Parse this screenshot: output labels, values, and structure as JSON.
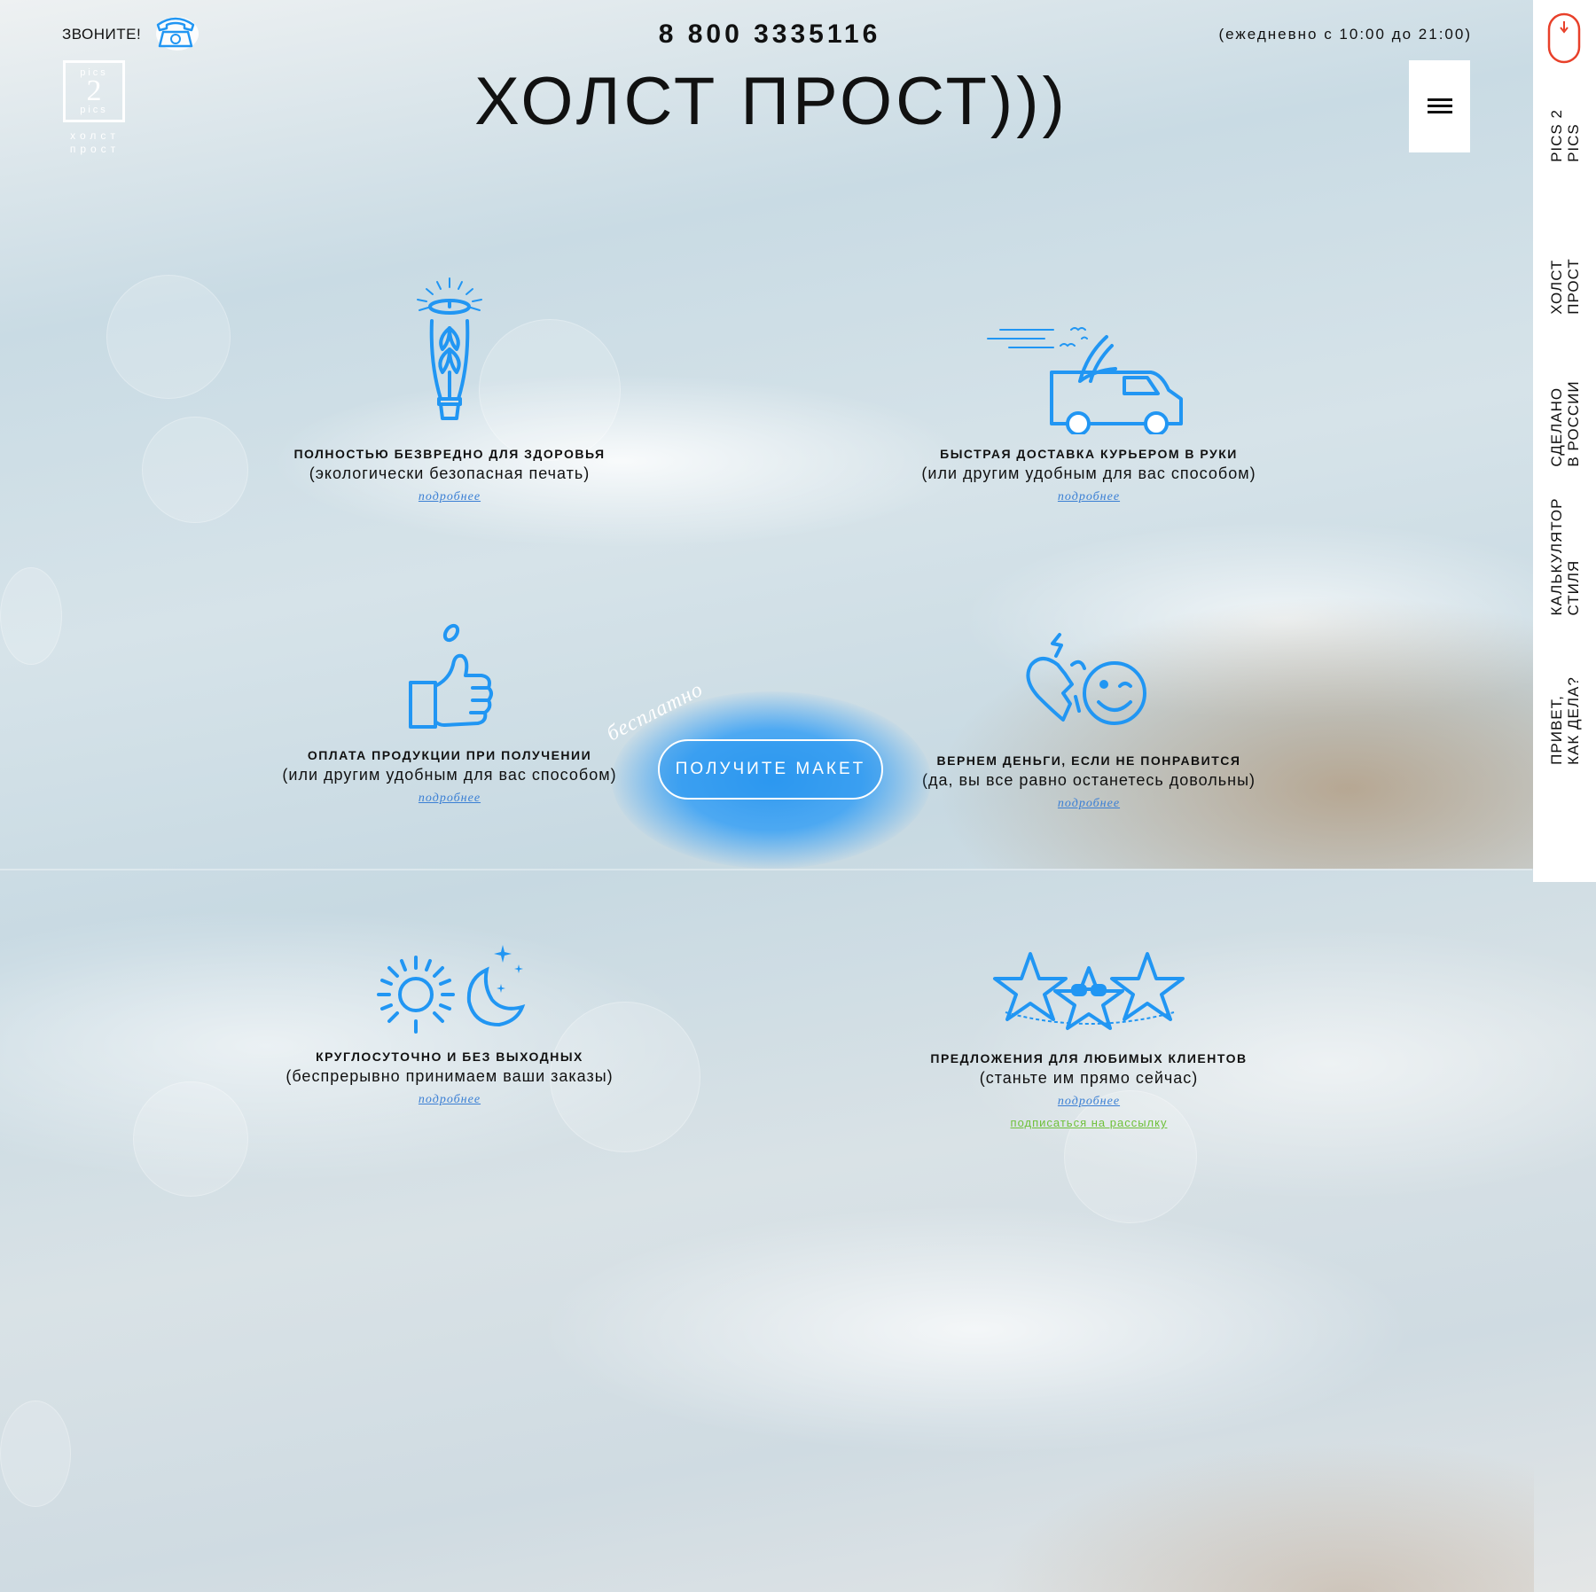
{
  "header": {
    "call_label": "ЗВОНИТЕ!",
    "phone_number": "8 800 3335116",
    "hours": "(ежедневно с 10:00 до 21:00)",
    "site_title": "ХОЛСТ ПРОСТ)))",
    "logo": {
      "top": "pics",
      "number": "2",
      "bottom": "pics",
      "caption_line1": "холст",
      "caption_line2": "прост"
    }
  },
  "side_nav": {
    "items": [
      {
        "label": "PICS 2\nPICS"
      },
      {
        "label": "ХОЛСТ\nПРОСТ"
      },
      {
        "label": "СДЕЛАНО\nВ РОССИИ"
      },
      {
        "label": "КАЛЬКУЛЯТОР\nСТИЛЯ"
      },
      {
        "label": "ПРИВЕТ,\nКАК ДЕЛА?"
      }
    ]
  },
  "features": [
    {
      "icon": "eco-plant-icon",
      "title": "ПОЛНОСТЬЮ БЕЗВРЕДНО ДЛЯ ЗДОРОВЬЯ",
      "subtitle": "(экологически безопасная печать)",
      "more": "подробнее"
    },
    {
      "icon": "delivery-van-icon",
      "title": "БЫСТРАЯ ДОСТАВКА КУРЬЕРОМ В РУКИ",
      "subtitle": "(или другим удобным для вас способом)",
      "more": "подробнее"
    },
    {
      "icon": "thumbs-up-icon",
      "title": "ОПЛАТА ПРОДУКЦИИ ПРИ ПОЛУЧЕНИИ",
      "subtitle": "(или другим удобным для вас способом)",
      "more": "подробнее"
    },
    {
      "icon": "heart-smile-icon",
      "title": "ВЕРНЕМ ДЕНЬГИ, ЕСЛИ НЕ ПОНРАВИТСЯ",
      "subtitle": "(да, вы все равно останетесь довольны)",
      "more": "подробнее"
    },
    {
      "icon": "sun-moon-icon",
      "title": "КРУГЛОСУТОЧНО И БЕЗ ВЫХОДНЫХ",
      "subtitle": "(беспрерывно принимаем ваши заказы)",
      "more": "подробнее"
    },
    {
      "icon": "stars-icon",
      "title": "ПРЕДЛОЖЕНИЯ ДЛЯ ЛЮБИМЫХ КЛИЕНТОВ",
      "subtitle": "(станьте им прямо сейчас)",
      "more": "подробнее",
      "subscribe": "подписаться на рассылку"
    }
  ],
  "cta": {
    "button": "ПОЛУЧИТЕ МАКЕТ",
    "free_label": "бесплатно"
  },
  "colors": {
    "accent_blue": "#2196f3",
    "link_blue": "#3a7fd4",
    "subscribe_green": "#6fc03a",
    "mouse_red": "#e8402a"
  }
}
